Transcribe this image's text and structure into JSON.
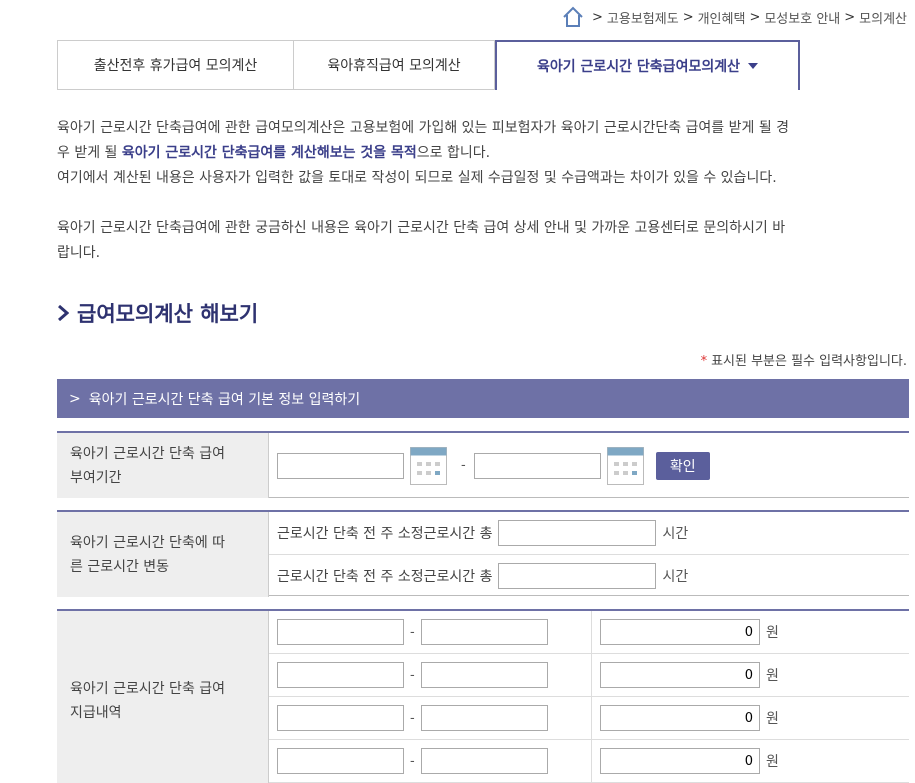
{
  "breadcrumb": {
    "items": [
      "고용보험제도",
      "개인혜택",
      "모성보호 안내",
      "모의계산"
    ]
  },
  "tabs": [
    {
      "label": "출산전후 휴가급여 모의계산"
    },
    {
      "label": "육아휴직급여 모의계산"
    },
    {
      "label": "육아기 근로시간 단축급여모의계산"
    }
  ],
  "intro": {
    "line1a": "육아기 근로시간 단축급여에 관한 급여모의계산은 고용보험에 가입해 있는 피보험자가 육아기 근로시간단축 급여를 받게 될 경",
    "line2a": "우 받게 될 ",
    "line2b": "육아기 근로시간 단축급여를 계산해보는 것을 목적",
    "line2c": "으로 합니다.",
    "line3": "여기에서 계산된 내용은 사용자가 입력한 값을 토대로 작성이 되므로 실제 수급일정 및 수급액과는 차이가 있을 수 있습니다.",
    "line4": "육아기 근로시간 단축급여에 관한 궁금하신 내용은 육아기 근로시간 단축 급여 상세 안내 및 가까운 고용센터로 문의하시기 바",
    "line5": "랍니다."
  },
  "section_title": "급여모의계산 해보기",
  "required_note": "표시된 부분은 필수 입력사항입니다.",
  "band_title": "육아기 근로시간 단축 급여 기본 정보 입력하기",
  "period": {
    "label_line1": "육아기 근로시간 단축 급여",
    "label_line2": "부여기간",
    "start": "",
    "end": "",
    "confirm": "확인"
  },
  "hours": {
    "label_line1": "육아기 근로시간 단축에 따",
    "label_line2": "른 근로시간 변동",
    "row1_label": "근로시간 단축 전 주 소정근로시간 총",
    "row1_value": "",
    "row2_label": "근로시간 단축 전 주 소정근로시간 총",
    "row2_value": "",
    "unit": "시간"
  },
  "payments": {
    "label_line1": "육아기 근로시간 단축 급여",
    "label_line2": "지급내역",
    "unit": "원",
    "rows": [
      {
        "amount": "0"
      },
      {
        "amount": "0"
      },
      {
        "amount": "0"
      },
      {
        "amount": "0"
      }
    ]
  }
}
